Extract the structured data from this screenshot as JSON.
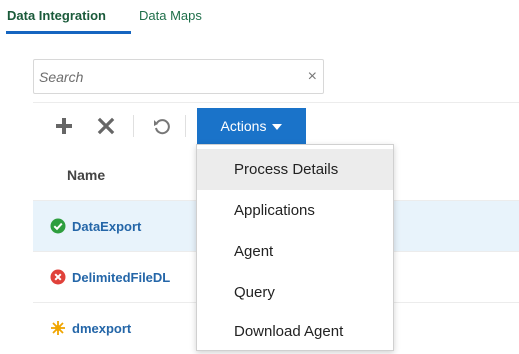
{
  "tabs": [
    {
      "label": "Data Integration",
      "active": true
    },
    {
      "label": "Data Maps",
      "active": false
    }
  ],
  "search": {
    "placeholder": "Search",
    "value": ""
  },
  "toolbar": {
    "add_icon": "plus-icon",
    "delete_icon": "x-icon",
    "refresh_icon": "refresh-icon",
    "actions_label": "Actions"
  },
  "table": {
    "columns": [
      "Name"
    ],
    "rows": [
      {
        "name": "DataExport",
        "status": "success",
        "status_color": "#2e9e3e",
        "selected": true
      },
      {
        "name": "DelimitedFileDL",
        "status": "error",
        "status_color": "#e0413a",
        "selected": false
      },
      {
        "name": "dmexport",
        "status": "pending",
        "status_color": "#f0a500",
        "selected": false
      }
    ]
  },
  "actions_menu": {
    "items": [
      "Process Details",
      "Applications",
      "Agent",
      "Query",
      "Download Agent"
    ],
    "hovered_index": 0
  },
  "colors": {
    "accent": "#1a73c9",
    "tab_underline": "#1565c0",
    "link": "#2466a8"
  }
}
